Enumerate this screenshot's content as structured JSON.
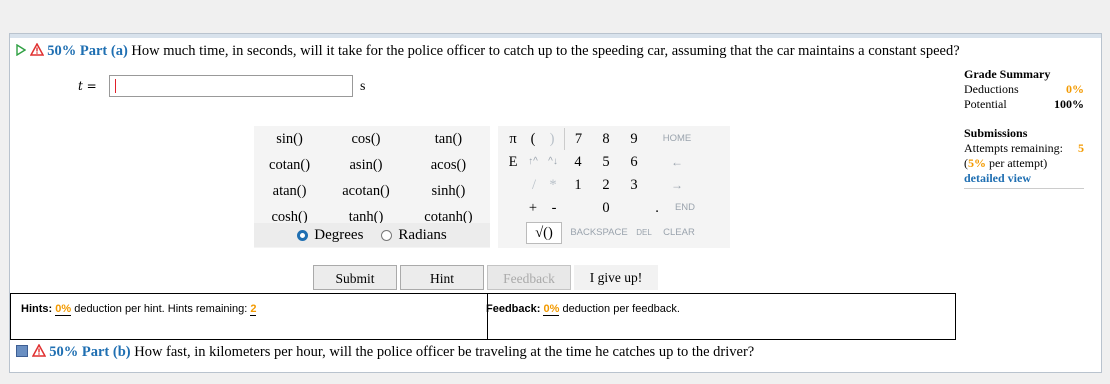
{
  "part_a": {
    "percent": "50%",
    "label": "Part (a)",
    "question": "How much time, in seconds, will it take for the police officer to catch up to the speeding car, assuming that the car maintains a constant speed?",
    "variable": "t =",
    "value": "",
    "unit": "s"
  },
  "grade": {
    "title": "Grade Summary",
    "deductions_label": "Deductions",
    "deductions_value": "0%",
    "potential_label": "Potential",
    "potential_value": "100%",
    "submissions_title": "Submissions",
    "attempts_label": "Attempts remaining:",
    "attempts_value": "5",
    "per_attempt_pct": "5%",
    "per_attempt_text": "per attempt)",
    "open_paren": "(",
    "detailed_view": "detailed view"
  },
  "functions": [
    [
      "sin()",
      "cos()",
      "tan()"
    ],
    [
      "cotan()",
      "asin()",
      "acos()"
    ],
    [
      "atan()",
      "acotan()",
      "sinh()"
    ],
    [
      "cosh()",
      "tanh()",
      "cotanh()"
    ]
  ],
  "mode": {
    "degrees": "Degrees",
    "radians": "Radians",
    "selected": "Degrees"
  },
  "keypad": {
    "pi": "π",
    "lparen": "(",
    "rparen": ")",
    "e": "E",
    "up": "↑^",
    "down": "^↓",
    "divide": "/",
    "multiply": "*",
    "plus": "+",
    "minus": "-",
    "sqrt": "√()",
    "dot": ".",
    "home": "HOME",
    "left": "←",
    "right": "→",
    "end": "END",
    "backspace": "BACKSPACE",
    "del": "DEL",
    "clear": "CLEAR",
    "d7": "7",
    "d8": "8",
    "d9": "9",
    "d4": "4",
    "d5": "5",
    "d6": "6",
    "d1": "1",
    "d2": "2",
    "d3": "3",
    "d0": "0"
  },
  "buttons": {
    "submit": "Submit",
    "hint": "Hint",
    "feedback": "Feedback",
    "give_up": "I give up!"
  },
  "hints": {
    "label": "Hints:",
    "pct": "0%",
    "text": "deduction per hint. Hints remaining:",
    "remaining": "2"
  },
  "feedback": {
    "label": "Feedback:",
    "pct": "0%",
    "text": "deduction per feedback."
  },
  "part_b": {
    "percent": "50%",
    "label": "Part (b)",
    "question": "How fast, in kilometers per hour, will the police officer be traveling at the time he catches up to the driver?"
  },
  "colors": {
    "accent": "#1f6fb2",
    "orange": "#f39a00",
    "warning": "#e03030"
  }
}
